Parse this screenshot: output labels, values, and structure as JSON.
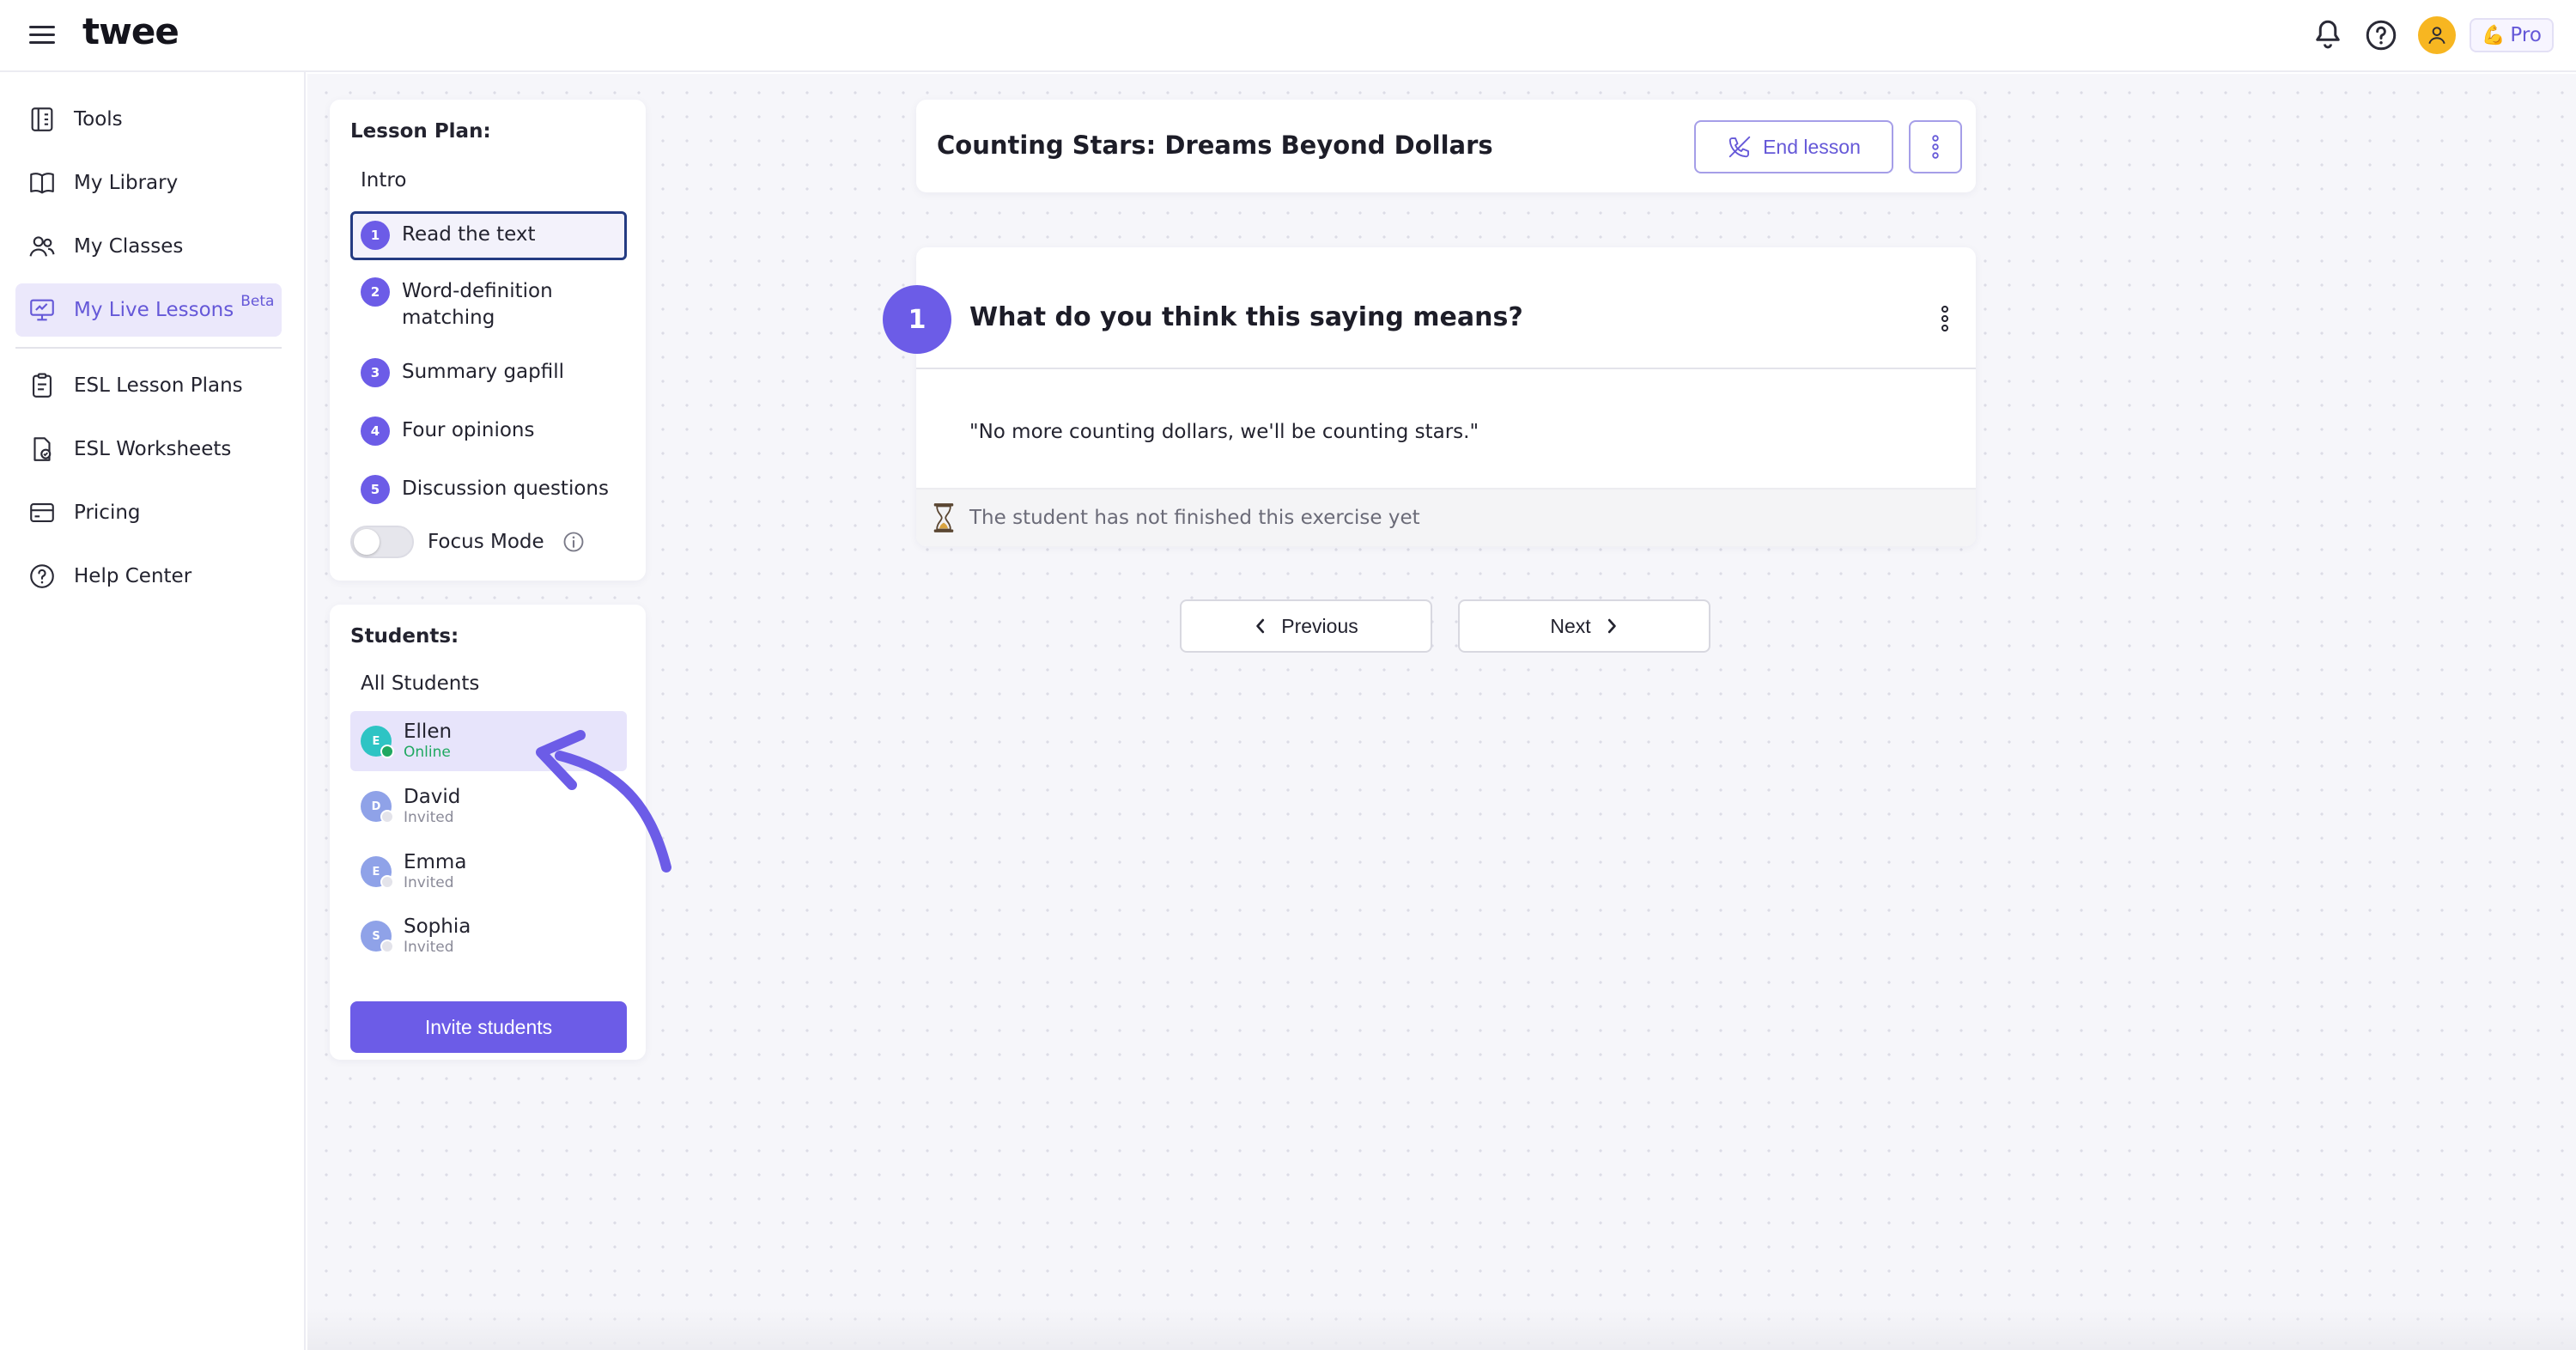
{
  "app": {
    "logo_text": "twee",
    "brand_color": "#6c5ce7"
  },
  "topbar": {
    "icons": [
      "menu-icon",
      "bell-icon",
      "help-icon",
      "user-icon"
    ],
    "pro_badge": {
      "emoji": "💪",
      "label": "Pro"
    }
  },
  "sidebar": {
    "items": [
      {
        "label": "Tools",
        "icon": "tools-icon"
      },
      {
        "label": "My Library",
        "icon": "book-icon"
      },
      {
        "label": "My Classes",
        "icon": "users-icon"
      },
      {
        "label": "My Live Lessons",
        "icon": "presentation-icon",
        "badge": "Beta",
        "active": true
      },
      {
        "label": "ESL Lesson Plans",
        "icon": "clipboard-icon"
      },
      {
        "label": "ESL Worksheets",
        "icon": "worksheet-icon"
      },
      {
        "label": "Pricing",
        "icon": "card-icon"
      },
      {
        "label": "Help Center",
        "icon": "help-circle-icon"
      }
    ]
  },
  "lesson_plan": {
    "heading": "Lesson Plan:",
    "intro": "Intro",
    "steps": [
      {
        "num": "1",
        "label": "Read the text",
        "active": true
      },
      {
        "num": "2",
        "label": "Word-definition matching"
      },
      {
        "num": "3",
        "label": "Summary gapfill"
      },
      {
        "num": "4",
        "label": "Four opinions"
      },
      {
        "num": "5",
        "label": "Discussion questions"
      }
    ],
    "focus_mode": {
      "label": "Focus Mode",
      "enabled": false
    }
  },
  "students": {
    "heading": "Students:",
    "all_label": "All Students",
    "list": [
      {
        "initial": "E",
        "name": "Ellen",
        "status": "Online",
        "color": "#2ec4c4",
        "dot": "#1fa860",
        "active": true
      },
      {
        "initial": "D",
        "name": "David",
        "status": "Invited",
        "color": "#8fa2e8",
        "dot": "#e3e3ea"
      },
      {
        "initial": "E",
        "name": "Emma",
        "status": "Invited",
        "color": "#8fa2e8",
        "dot": "#e3e3ea"
      },
      {
        "initial": "S",
        "name": "Sophia",
        "status": "Invited",
        "color": "#8fa2e8",
        "dot": "#e3e3ea"
      }
    ],
    "invite_label": "Invite students"
  },
  "lesson": {
    "title": "Counting Stars: Dreams Beyond Dollars",
    "end_label": "End lesson"
  },
  "exercise": {
    "number": "1",
    "question": "What do you think this saying means?",
    "quote": "\"No more counting dollars, we'll be counting stars.\"",
    "status_text": "The student has not finished this exercise yet",
    "status_icon": "hourglass-icon"
  },
  "pager": {
    "previous_label": "Previous",
    "next_label": "Next"
  }
}
